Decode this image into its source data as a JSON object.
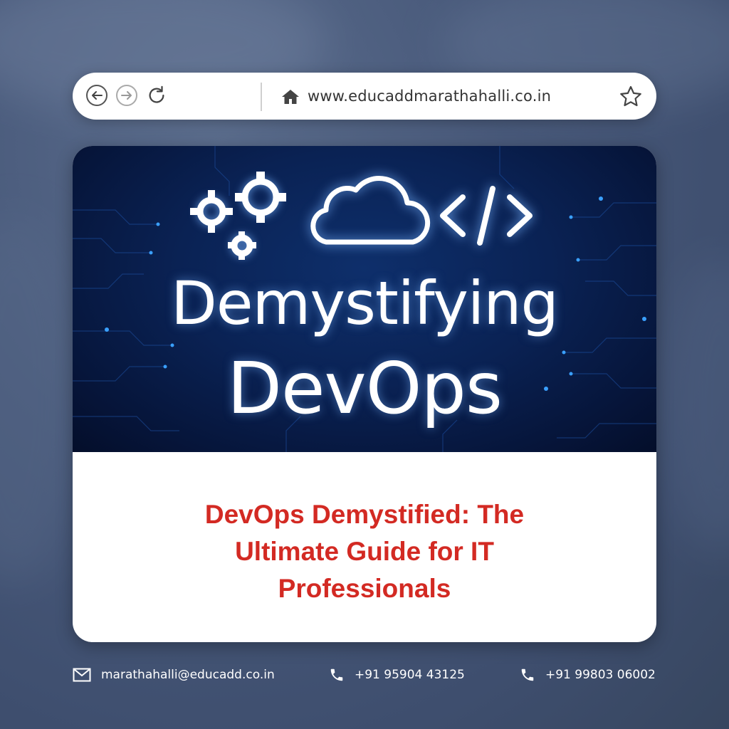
{
  "browser": {
    "url": "www.educaddmarathahalli.co.in",
    "nav_icons": [
      "back-icon",
      "forward-icon",
      "reload-icon"
    ],
    "home_icon": "home-icon",
    "bookmark_icon": "star-icon"
  },
  "banner": {
    "line1": "Demystifying",
    "line2": "DevOps",
    "icons": [
      "gears-icon",
      "cloud-icon",
      "code-icon"
    ]
  },
  "headline": {
    "line1": "DevOps Demystified: The",
    "line2": "Ultimate Guide for IT",
    "line3": "Professionals"
  },
  "footer": {
    "email": "marathahalli@educadd.co.in",
    "phone1": "+91 95904 43125",
    "phone2": "+91 99803 06002"
  },
  "colors": {
    "headline": "#d32a23",
    "background": "#48597a",
    "banner": "#0a2254"
  }
}
